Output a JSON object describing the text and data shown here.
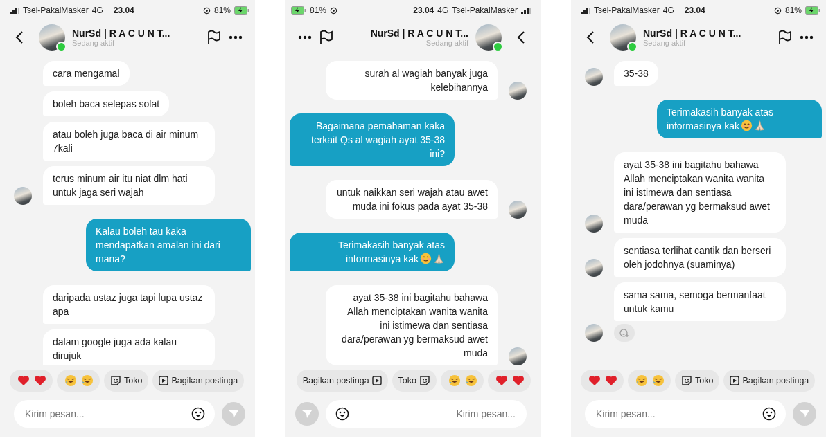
{
  "phones": [
    {
      "mirrored": false,
      "status_bar": {
        "carrier": "Tsel-PakaiMasker",
        "network": "4G",
        "time": "23.04",
        "battery": "81%"
      },
      "header": {
        "name": "NurSd | R A C U N T...",
        "status": "Sedang aktif",
        "online": true
      },
      "messages": [
        {
          "kind": "received",
          "avatar": false,
          "text": "cara mengamal"
        },
        {
          "kind": "received",
          "avatar": false,
          "text": "boleh baca selepas solat"
        },
        {
          "kind": "received",
          "avatar": false,
          "text": "atau boleh juga baca di air minum 7kali"
        },
        {
          "kind": "received",
          "avatar": true,
          "text": "terus minum air itu niat dlm hati untuk jaga seri wajah"
        },
        {
          "kind": "sent",
          "text": "Kalau boleh tau kaka mendapatkan amalan ini dari mana?"
        },
        {
          "kind": "received",
          "avatar": false,
          "text": "daripada ustaz juga tapi lupa ustaz apa"
        },
        {
          "kind": "received",
          "avatar": false,
          "text": "dalam google juga ada kalau dirujuk"
        }
      ],
      "quick_replies": [
        {
          "kind": "hearts"
        },
        {
          "kind": "laugh"
        },
        {
          "kind": "sticker",
          "label": "Toko"
        },
        {
          "kind": "video",
          "label": "Bagikan postinga"
        }
      ],
      "composer": {
        "placeholder": "Kirim pesan..."
      }
    },
    {
      "mirrored": true,
      "status_bar": {
        "carrier": "Tsel-PakaiMasker",
        "network": "4G",
        "time": "23.04",
        "battery": "81%"
      },
      "header": {
        "name": "NurSd | R A C U N T...",
        "status": "Sedang aktif",
        "online": true
      },
      "messages": [
        {
          "kind": "received",
          "avatar": true,
          "text": "surah al wagiah banyak juga kelebihannya"
        },
        {
          "kind": "sent",
          "text": "Bagaimana pemahaman kaka terkait Qs al wagiah ayat 35-38 ini?"
        },
        {
          "kind": "received",
          "avatar": true,
          "text": "untuk naikkan seri wajah atau awet muda ini fokus pada ayat 35-38"
        },
        {
          "kind": "sent",
          "text": "Terimakasih banyak atas informasinya kak",
          "emojis": [
            {
              "kind": "smile"
            },
            {
              "kind": "pray"
            }
          ]
        },
        {
          "kind": "received",
          "avatar": true,
          "text": "ayat 35-38 ini bagitahu bahawa Allah menciptakan wanita wanita ini istimewa dan sentiasa dara/perawan yg bermaksud awet muda"
        }
      ],
      "quick_replies": [
        {
          "kind": "video",
          "label": "Bagikan postinga"
        },
        {
          "kind": "sticker",
          "label": "Toko"
        },
        {
          "kind": "laugh"
        },
        {
          "kind": "hearts"
        }
      ],
      "composer": {
        "placeholder": "Kirim pesan..."
      }
    },
    {
      "mirrored": false,
      "status_bar": {
        "carrier": "Tsel-PakaiMasker",
        "network": "4G",
        "time": "23.04",
        "battery": "81%"
      },
      "header": {
        "name": "NurSd | R A C U N T...",
        "status": "Sedang aktif",
        "online": true
      },
      "messages": [
        {
          "kind": "received",
          "avatar": true,
          "text": "35-38"
        },
        {
          "kind": "sent",
          "text": "Terimakasih banyak atas informasinya kak",
          "emojis": [
            {
              "kind": "smile"
            },
            {
              "kind": "pray"
            }
          ]
        },
        {
          "kind": "received",
          "avatar": true,
          "text": "ayat 35-38 ini bagitahu bahawa Allah menciptakan wanita wanita ini istimewa dan sentiasa dara/perawan yg bermaksud awet muda"
        },
        {
          "kind": "received",
          "avatar": true,
          "text": "sentiasa terlihat cantik dan berseri oleh jodohnya (suaminya)"
        },
        {
          "kind": "received",
          "avatar": true,
          "text": "sama sama, semoga bermanfaat untuk kamu",
          "reaction_button": true
        }
      ],
      "quick_replies": [
        {
          "kind": "hearts"
        },
        {
          "kind": "laugh"
        },
        {
          "kind": "sticker",
          "label": "Toko"
        },
        {
          "kind": "video",
          "label": "Bagikan postinga"
        }
      ],
      "composer": {
        "placeholder": "Kirim pesan..."
      }
    }
  ]
}
